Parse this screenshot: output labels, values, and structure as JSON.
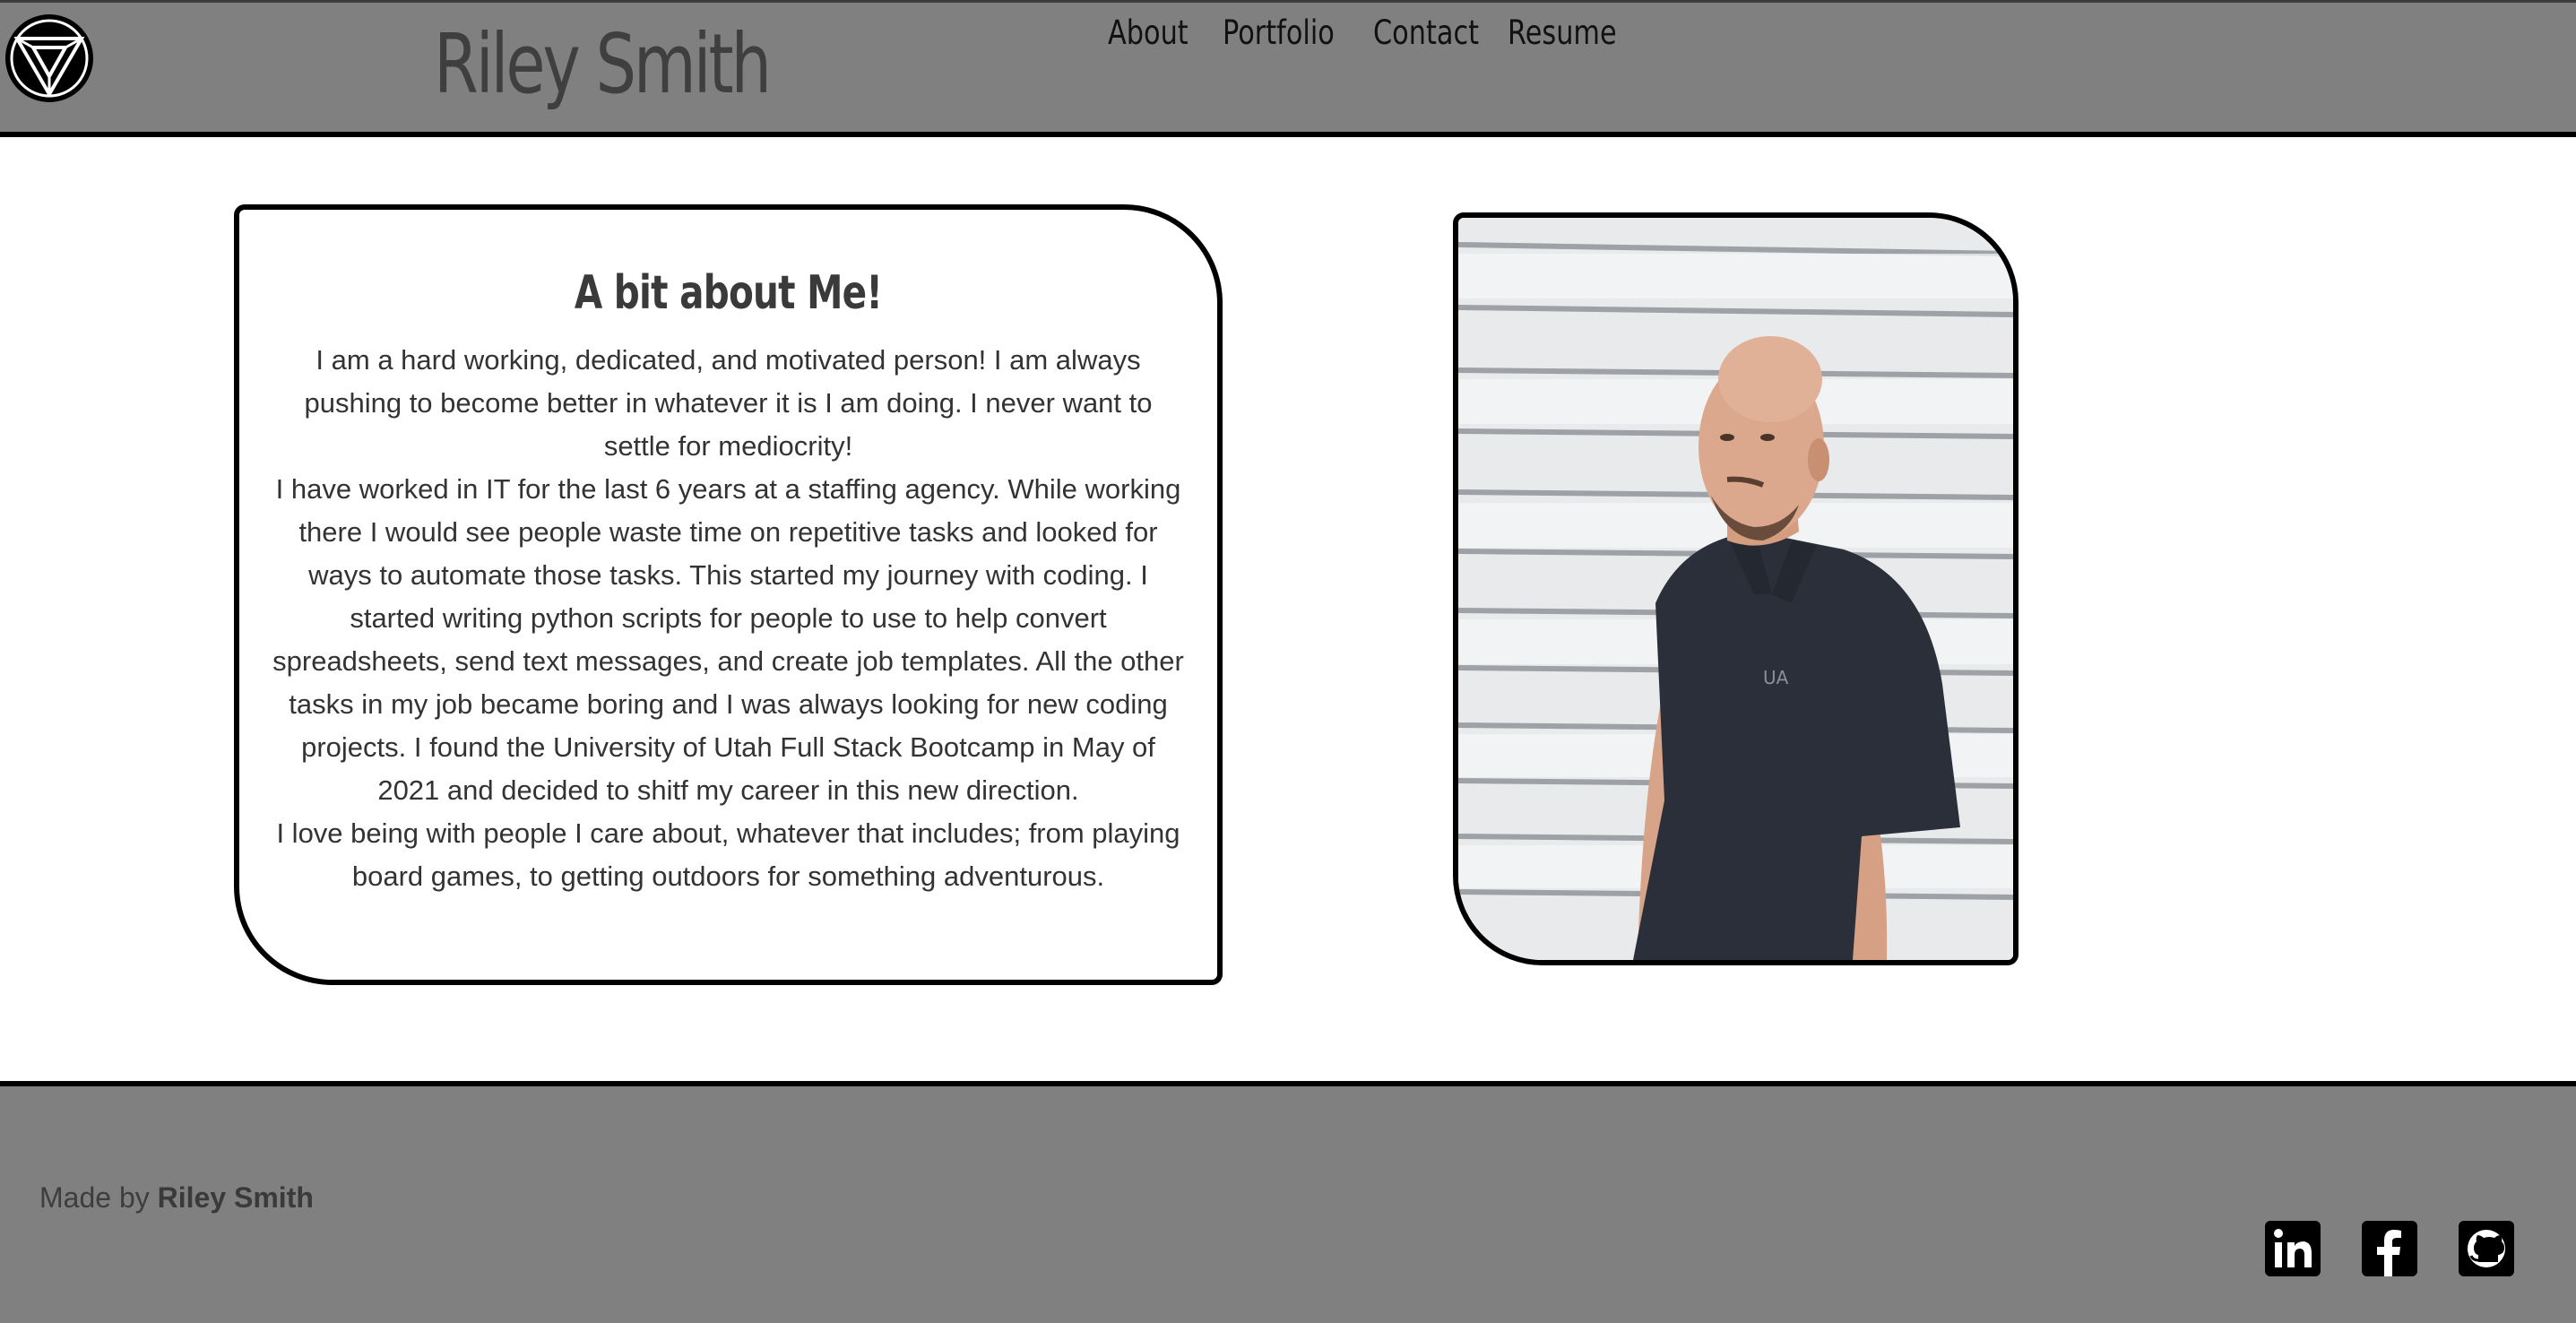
{
  "header": {
    "logo_icon": "triangle-logo-icon",
    "title": "Riley Smith",
    "nav": [
      {
        "label": "About"
      },
      {
        "label": "Portfolio"
      },
      {
        "label": "Contact"
      },
      {
        "label": "Resume"
      }
    ]
  },
  "about": {
    "heading": "A bit about Me!",
    "paragraphs": [
      "I am a hard working, dedicated, and motivated person! I am always pushing to become better in whatever it is I am doing. I never want to settle for mediocrity!",
      "I have worked in IT for the last 6 years at a staffing agency. While working there I would see people waste time on repetitive tasks and looked for ways to automate those tasks. This started my journey with coding. I started writing python scripts for people to use to help convert spreadsheets, send text messages, and create job templates. All the other tasks in my job became boring and I was always looking for new coding projects. I found the University of Utah Full Stack Bootcamp in May of 2021 and decided to shitf my career in this new direction.",
      "I love being with people I care about, whatever that includes; from playing board games, to getting outdoors for something adventurous."
    ]
  },
  "photo": {
    "subject": "profile-photo"
  },
  "footer": {
    "made_by_prefix": "Made by ",
    "made_by_name": "Riley Smith",
    "social": [
      {
        "icon": "linkedin-icon"
      },
      {
        "icon": "facebook-icon"
      },
      {
        "icon": "github-icon"
      }
    ]
  },
  "colors": {
    "header_bg": "#808080",
    "footer_bg": "#808080",
    "border": "#000000",
    "text_dark": "#3f3f3f"
  }
}
